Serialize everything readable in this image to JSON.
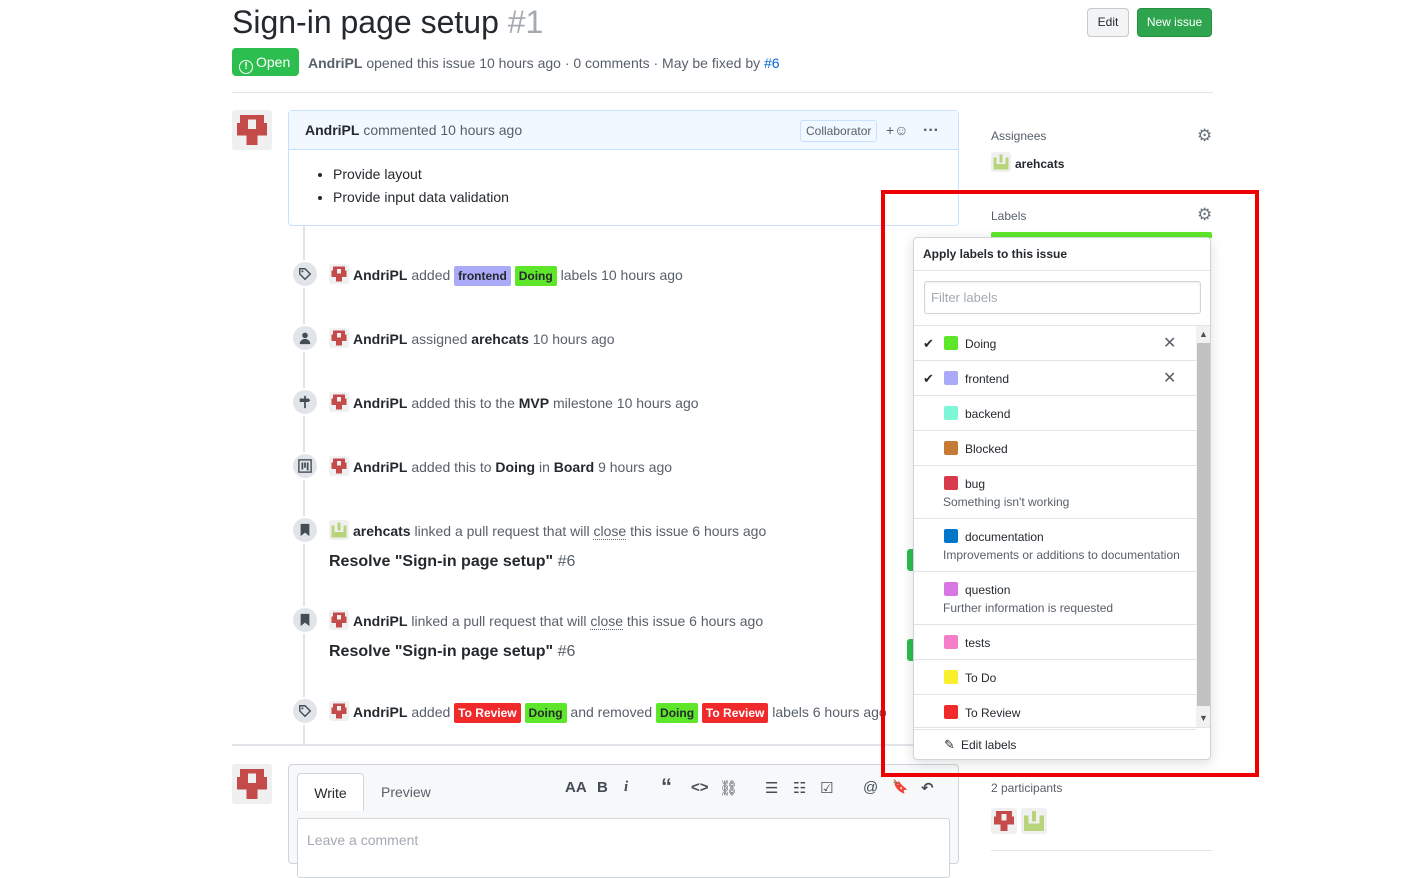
{
  "header": {
    "title": "Sign-in page setup",
    "number": "#1",
    "edit_label": "Edit",
    "new_issue_label": "New issue",
    "state": "Open",
    "author": "AndriPL",
    "opened_text": "opened this issue 10 hours ago · 0 comments · May be fixed by",
    "fix_ref": "#6"
  },
  "comment": {
    "author": "AndriPL",
    "action": "commented 10 hours ago",
    "badge": "Collaborator",
    "emoji": "+☺",
    "more": "···",
    "items": [
      "Provide layout",
      "Provide input data validation"
    ]
  },
  "timeline": {
    "ev1": {
      "actor": "AndriPL",
      "verb": "added",
      "labels": [
        "frontend",
        "Doing"
      ],
      "tail": "labels 10 hours ago"
    },
    "ev2": {
      "actor": "AndriPL",
      "verb": "assigned",
      "target": "arehcats",
      "tail": "10 hours ago"
    },
    "ev3": {
      "actor": "AndriPL",
      "verb": "added this to the",
      "target": "MVP",
      "tail": "milestone 10 hours ago"
    },
    "ev4": {
      "actor": "AndriPL",
      "verb": "added this to",
      "column": "Doing",
      "in": "in",
      "board": "Board",
      "tail": "9 hours ago"
    },
    "ev5": {
      "actor": "arehcats",
      "verb": "linked a pull request that will",
      "close": "close",
      "tail": "this issue 6 hours ago",
      "pr_title": "Resolve \"Sign-in page setup\"",
      "pr_num": "#6"
    },
    "ev6": {
      "actor": "AndriPL",
      "verb": "linked a pull request that will",
      "close": "close",
      "tail": "this issue 6 hours ago",
      "pr_title": "Resolve \"Sign-in page setup\"",
      "pr_num": "#6"
    },
    "ev7": {
      "actor": "AndriPL",
      "verb": "added",
      "added": [
        "To Review",
        "Doing"
      ],
      "mid": "and removed",
      "removed": [
        "Doing",
        "To Review"
      ],
      "tail": "labels 6 hours ago"
    }
  },
  "editor": {
    "write_tab": "Write",
    "preview_tab": "Preview",
    "placeholder": "Leave a comment",
    "toolbar": {
      "heading": "AA",
      "bold": "B",
      "italic": "i",
      "quote": "“",
      "code": "<>",
      "link": "⛓",
      "ul": "☰",
      "ol": "☷",
      "task": "☑",
      "mention": "@",
      "ref": "🔖",
      "reply": "↶"
    }
  },
  "sidebar": {
    "assignees_title": "Assignees",
    "assignee": "arehcats",
    "labels_title": "Labels",
    "participants_title": "2 participants"
  },
  "label_menu": {
    "title": "Apply labels to this issue",
    "filter_placeholder": "Filter labels",
    "items": [
      {
        "name": "Doing",
        "color": "#5ee72a",
        "selected": true,
        "desc": ""
      },
      {
        "name": "frontend",
        "color": "#aaaaf8",
        "selected": true,
        "desc": ""
      },
      {
        "name": "backend",
        "color": "#7ef7d8",
        "selected": false,
        "desc": ""
      },
      {
        "name": "Blocked",
        "color": "#c57a35",
        "selected": false,
        "desc": ""
      },
      {
        "name": "bug",
        "color": "#d73a4a",
        "selected": false,
        "desc": "Something isn't working"
      },
      {
        "name": "documentation",
        "color": "#0075ca",
        "selected": false,
        "desc": "Improvements or additions to documentation"
      },
      {
        "name": "question",
        "color": "#d876e3",
        "selected": false,
        "desc": "Further information is requested"
      },
      {
        "name": "tests",
        "color": "#f47fc8",
        "selected": false,
        "desc": ""
      },
      {
        "name": "To Do",
        "color": "#f8f02a",
        "selected": false,
        "desc": ""
      },
      {
        "name": "To Review",
        "color": "#f02a2a",
        "selected": false,
        "desc": ""
      }
    ],
    "check_glyph": "✔",
    "remove_glyph": "✕",
    "edit_labels": "Edit labels"
  },
  "colors": {
    "label_frontend": "#aaaaf8",
    "label_doing": "#5ee72a",
    "label_to_review": "#f02a2a",
    "open_green": "#2cbe4e",
    "highlight_red": "#ee0000"
  }
}
